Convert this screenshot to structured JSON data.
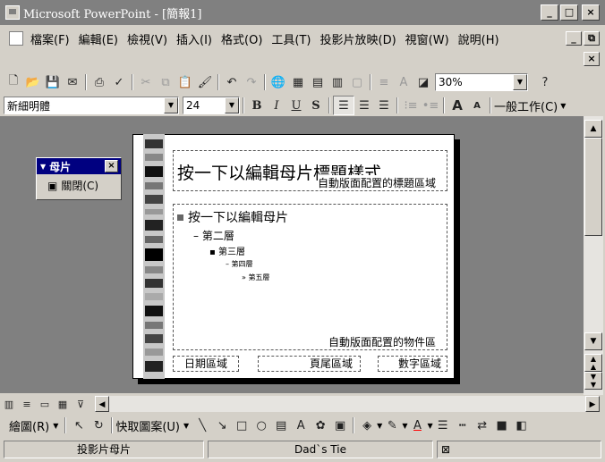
{
  "window": {
    "title": "Microsoft PowerPoint - [簡報1]",
    "min": "_",
    "max": "□",
    "close": "×"
  },
  "menubar": {
    "items": [
      "檔案(F)",
      "編輯(E)",
      "檢視(V)",
      "插入(I)",
      "格式(O)",
      "工具(T)",
      "投影片放映(D)",
      "視窗(W)",
      "說明(H)"
    ],
    "doc_min": "_",
    "doc_restore": "⧉",
    "doc_close": "×"
  },
  "toolbar_standard": {
    "zoom": "30%"
  },
  "toolbar_format": {
    "font": "新細明體",
    "size": "24",
    "bold": "B",
    "italic": "I",
    "underline": "U",
    "shadow": "S",
    "common_tasks": "一般工作(C)"
  },
  "master_toolbar": {
    "title": "母片",
    "close_label": "關閉(C)"
  },
  "slide": {
    "title_placeholder": "按一下以編輯母片標題樣式",
    "title_area_label": "自動版面配置的標題區域",
    "body_level1": "按一下以編輯母片",
    "body_level2": "第二層",
    "body_level3": "第三層",
    "body_level4": "第四層",
    "body_level5": "第五層",
    "body_area_label": "自動版面配置的物件區",
    "date_area": "日期區域",
    "footer_area": "頁尾區域",
    "number_area": "數字區域"
  },
  "drawing_toolbar": {
    "draw": "繪圖(R)",
    "autoshapes": "快取圖案(U)"
  },
  "statusbar": {
    "view": "投影片母片",
    "design": "Dad`s Tie"
  }
}
